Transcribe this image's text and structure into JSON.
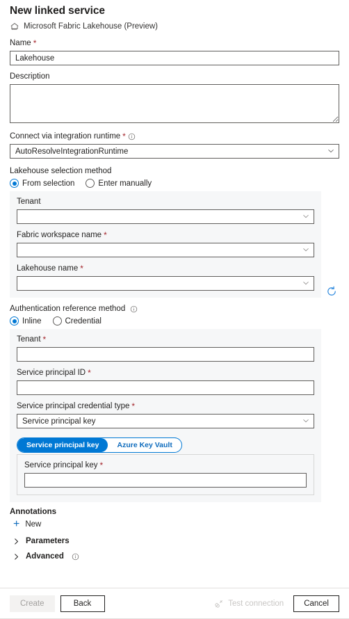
{
  "header": {
    "title": "New linked service",
    "connector_icon": "lakehouse-icon",
    "connector": "Microsoft Fabric Lakehouse (Preview)"
  },
  "form": {
    "name": {
      "label": "Name",
      "required": "*",
      "value": "Lakehouse",
      "placeholder": ""
    },
    "description": {
      "label": "Description",
      "value": "",
      "placeholder": ""
    },
    "integration_runtime": {
      "label": "Connect via integration runtime",
      "required": "*",
      "info_icon": "info-icon",
      "value": "AutoResolveIntegrationRuntime"
    },
    "lakehouse_selection_method": {
      "label": "Lakehouse selection method",
      "options": [
        {
          "label": "From selection",
          "selected": true
        },
        {
          "label": "Enter manually",
          "selected": false
        }
      ]
    },
    "selection_panel": {
      "tenant": {
        "label": "Tenant",
        "required": "",
        "value": "",
        "placeholder": ""
      },
      "workspace": {
        "label": "Fabric workspace name",
        "required": "*",
        "value": "",
        "placeholder": ""
      },
      "lakehouse": {
        "label": "Lakehouse name",
        "required": "*",
        "value": "",
        "placeholder": ""
      },
      "refresh_icon": "refresh-icon"
    },
    "auth_reference_method": {
      "label": "Authentication reference method",
      "info_icon": "info-icon",
      "options": [
        {
          "label": "Inline",
          "selected": true
        },
        {
          "label": "Credential",
          "selected": false
        }
      ]
    },
    "auth_panel": {
      "tenant": {
        "label": "Tenant",
        "required": "*",
        "value": "",
        "placeholder": ""
      },
      "service_principal_id": {
        "label": "Service principal ID",
        "required": "*",
        "value": "",
        "placeholder": ""
      },
      "credential_type": {
        "label": "Service principal credential type",
        "required": "*",
        "value": "Service principal key"
      },
      "credential_tabs": [
        {
          "label": "Service principal key",
          "active": true
        },
        {
          "label": "Azure Key Vault",
          "active": false
        }
      ],
      "service_principal_key": {
        "label": "Service principal key",
        "required": "*",
        "value": "",
        "placeholder": ""
      }
    },
    "annotations": {
      "title": "Annotations",
      "new_label": "New",
      "new_icon": "plus-icon"
    },
    "collapsibles": [
      {
        "label": "Parameters",
        "icon": "chevron-right-icon",
        "info": false
      },
      {
        "label": "Advanced",
        "icon": "chevron-right-icon",
        "info": true
      }
    ]
  },
  "footer": {
    "create_label": "Create",
    "back_label": "Back",
    "test_connection_label": "Test connection",
    "test_connection_icon": "plug-disconnected-icon",
    "cancel_label": "Cancel"
  },
  "colors": {
    "accent": "#0078d4",
    "link": "#0f6cbd",
    "required": "#a4262c",
    "panel": "#f6f7f8",
    "border": "#605e5c",
    "disabled_text": "#a19f9d"
  }
}
